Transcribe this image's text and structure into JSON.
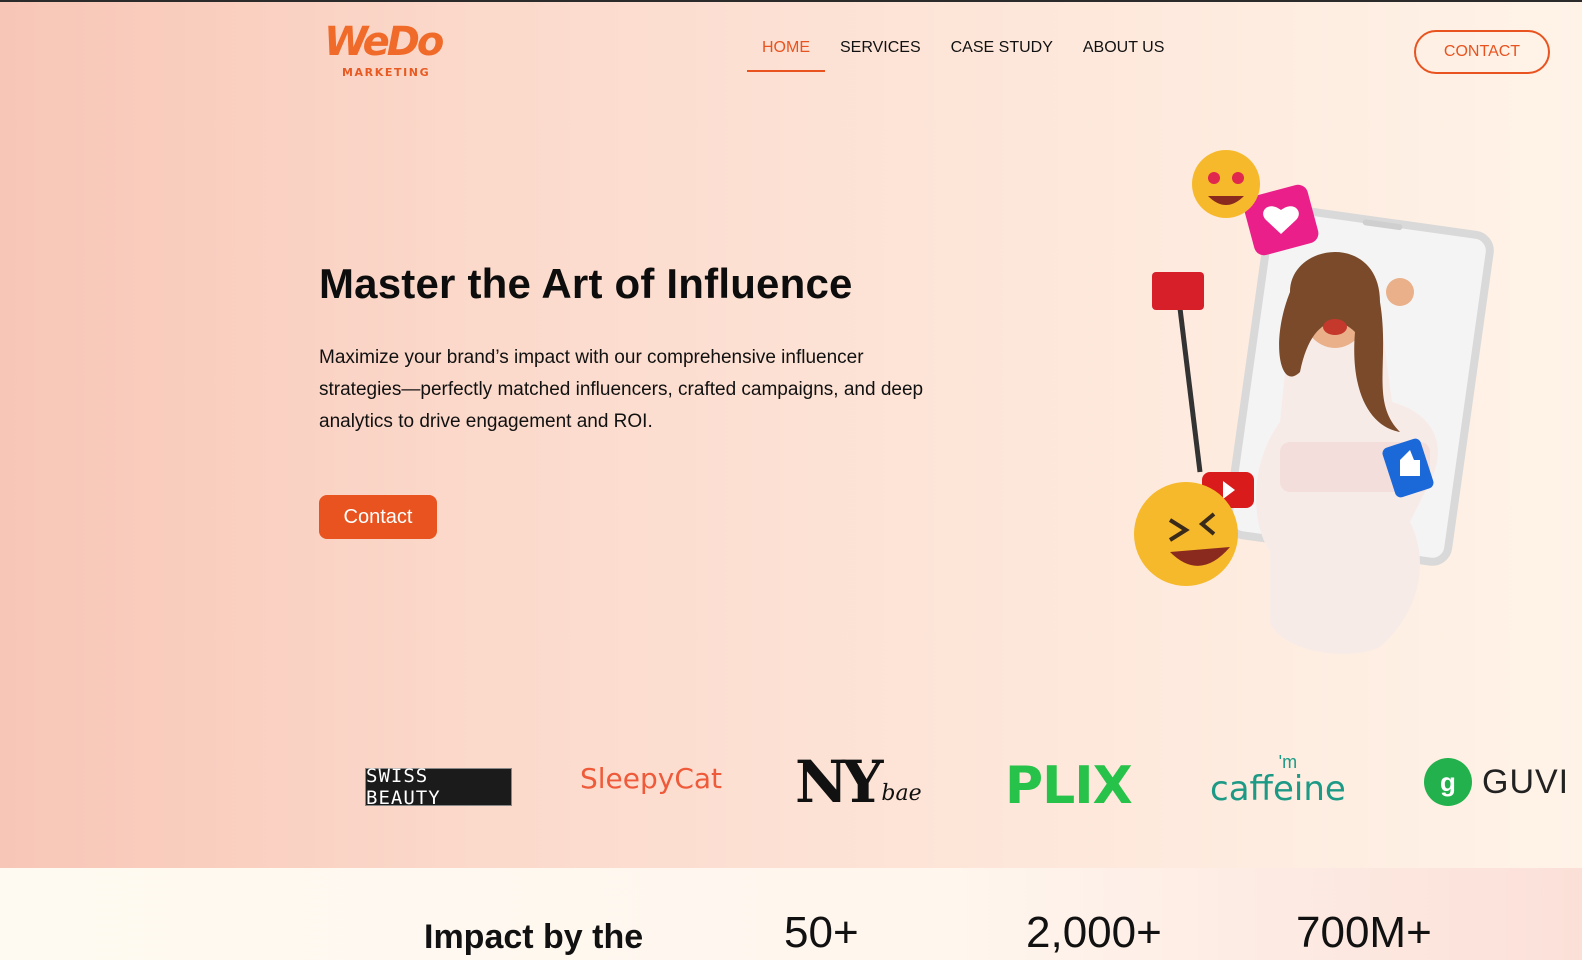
{
  "header": {
    "logo": {
      "main": "WeDo",
      "sub": "MARKETING"
    },
    "nav": [
      {
        "label": "HOME",
        "active": true
      },
      {
        "label": "SERVICES",
        "active": false
      },
      {
        "label": "CASE STUDY",
        "active": false
      },
      {
        "label": "ABOUT US",
        "active": false
      }
    ],
    "contact_label": "CONTACT"
  },
  "hero": {
    "title": "Master the Art of Influence",
    "description": "Maximize your brand’s impact with our comprehensive influencer strategies—perfectly matched influencers, crafted campaigns, and deep analytics to drive engagement and ROI.",
    "button_label": "Contact"
  },
  "brands": {
    "swiss": "SWISS BEAUTY",
    "sleepy": "SleepyCat",
    "ny_big": "NY",
    "ny_small": "bae",
    "plix": "PLIX",
    "caffeine_im": "'m",
    "caffeine_word": "caffeine",
    "guvi": "GUVI"
  },
  "impact": {
    "title": "Impact by the",
    "stats": [
      "50+",
      "2,000+",
      "700M+"
    ]
  },
  "colors": {
    "accent": "#e8531f",
    "brand_green": "#27c24a",
    "caffeine_teal": "#1c9a86"
  }
}
